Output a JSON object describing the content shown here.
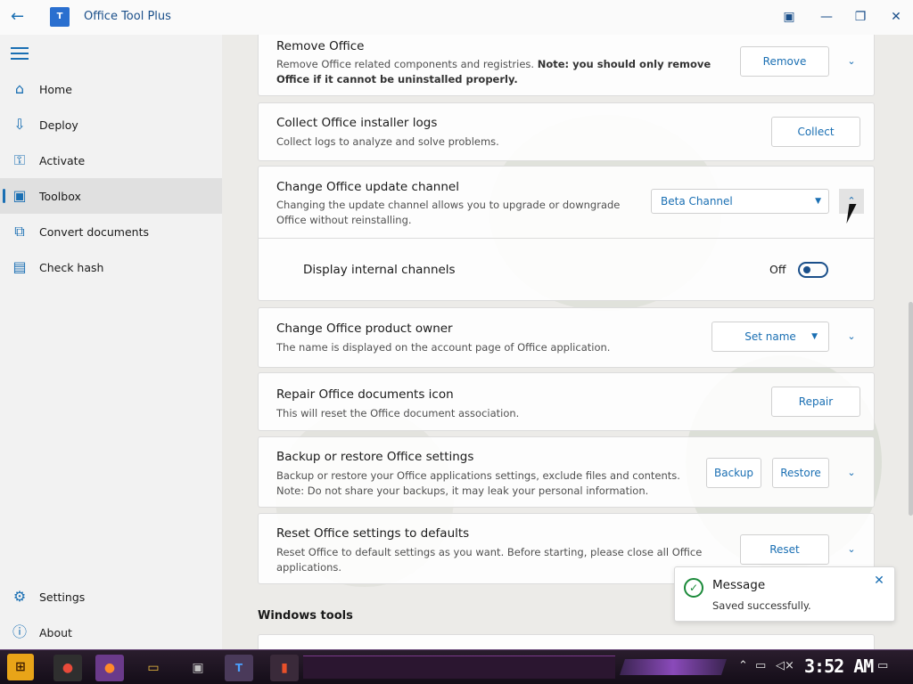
{
  "app": {
    "title": "Office Tool Plus",
    "logo_text": "T"
  },
  "window_controls": {
    "terminal_icon": "▣",
    "minimize": "—",
    "maximize": "❐",
    "close": "✕"
  },
  "sidebar": {
    "items": [
      {
        "label": "Home",
        "icon": "home-icon"
      },
      {
        "label": "Deploy",
        "icon": "deploy-icon"
      },
      {
        "label": "Activate",
        "icon": "key-icon"
      },
      {
        "label": "Toolbox",
        "icon": "toolbox-icon"
      },
      {
        "label": "Convert documents",
        "icon": "convert-icon"
      },
      {
        "label": "Check hash",
        "icon": "hash-icon"
      }
    ],
    "footer": [
      {
        "label": "Settings",
        "icon": "gear-icon"
      },
      {
        "label": "About",
        "icon": "info-icon"
      }
    ]
  },
  "cards": {
    "remove_office": {
      "title": "Remove Office",
      "desc_normal": "Remove Office related components and registries. ",
      "desc_bold": "Note: you should only remove Office if it cannot be uninstalled properly.",
      "button": "Remove"
    },
    "collect_logs": {
      "title": "Collect Office installer logs",
      "desc": "Collect logs to analyze and solve problems.",
      "button": "Collect"
    },
    "update_channel": {
      "title": "Change Office update channel",
      "desc": "Changing the update channel allows you to upgrade or downgrade Office without reinstalling.",
      "selected": "Beta Channel",
      "sub_label": "Display internal channels",
      "toggle_state": "Off"
    },
    "product_owner": {
      "title": "Change Office product owner",
      "desc": "The name is displayed on the account page of Office application.",
      "button": "Set name"
    },
    "repair_icon": {
      "title": "Repair Office documents icon",
      "desc": "This will reset the Office document association.",
      "button": "Repair"
    },
    "backup_restore": {
      "title": "Backup or restore Office settings",
      "desc": "Backup or restore your Office applications settings, exclude files and contents. Note: Do not share your backups, it may leak your personal information.",
      "backup_button": "Backup",
      "restore_button": "Restore"
    },
    "reset_settings": {
      "title": "Reset Office settings to defaults",
      "desc": "Reset Office to default settings as you want. Before starting, please close all Office applications.",
      "button": "Reset"
    }
  },
  "sections": {
    "windows_tools": "Windows tools"
  },
  "toast": {
    "title": "Message",
    "body": "Saved successfully."
  },
  "taskbar": {
    "clock": "3:52 AM"
  }
}
